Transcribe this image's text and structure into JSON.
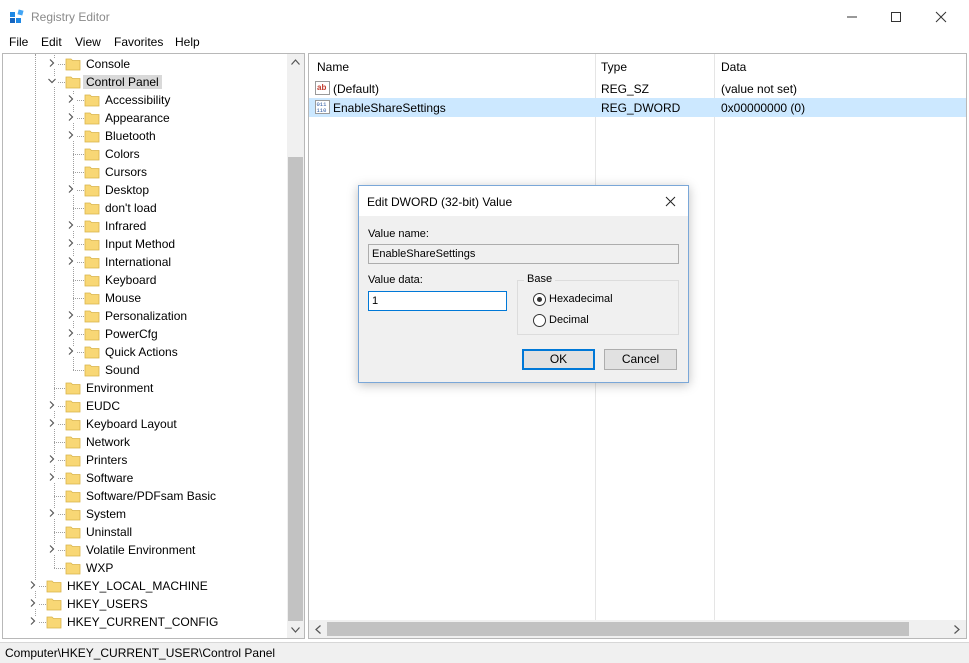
{
  "window": {
    "title": "Registry Editor"
  },
  "menu": [
    "File",
    "Edit",
    "View",
    "Favorites",
    "Help"
  ],
  "tree": {
    "items": [
      {
        "label": "Console",
        "level": 1,
        "expander": "collapsed"
      },
      {
        "label": "Control Panel",
        "level": 1,
        "expander": "expanded",
        "selected": true
      },
      {
        "label": "Accessibility",
        "level": 2,
        "expander": "collapsed"
      },
      {
        "label": "Appearance",
        "level": 2,
        "expander": "collapsed"
      },
      {
        "label": "Bluetooth",
        "level": 2,
        "expander": "collapsed"
      },
      {
        "label": "Colors",
        "level": 2,
        "expander": "none"
      },
      {
        "label": "Cursors",
        "level": 2,
        "expander": "none"
      },
      {
        "label": "Desktop",
        "level": 2,
        "expander": "collapsed"
      },
      {
        "label": "don't load",
        "level": 2,
        "expander": "none"
      },
      {
        "label": "Infrared",
        "level": 2,
        "expander": "collapsed"
      },
      {
        "label": "Input Method",
        "level": 2,
        "expander": "collapsed"
      },
      {
        "label": "International",
        "level": 2,
        "expander": "collapsed"
      },
      {
        "label": "Keyboard",
        "level": 2,
        "expander": "none"
      },
      {
        "label": "Mouse",
        "level": 2,
        "expander": "none"
      },
      {
        "label": "Personalization",
        "level": 2,
        "expander": "collapsed"
      },
      {
        "label": "PowerCfg",
        "level": 2,
        "expander": "collapsed"
      },
      {
        "label": "Quick Actions",
        "level": 2,
        "expander": "collapsed"
      },
      {
        "label": "Sound",
        "level": 2,
        "expander": "none"
      },
      {
        "label": "Environment",
        "level": 1,
        "expander": "none"
      },
      {
        "label": "EUDC",
        "level": 1,
        "expander": "collapsed"
      },
      {
        "label": "Keyboard Layout",
        "level": 1,
        "expander": "collapsed"
      },
      {
        "label": "Network",
        "level": 1,
        "expander": "none"
      },
      {
        "label": "Printers",
        "level": 1,
        "expander": "collapsed"
      },
      {
        "label": "Software",
        "level": 1,
        "expander": "collapsed"
      },
      {
        "label": "Software/PDFsam Basic",
        "level": 1,
        "expander": "none"
      },
      {
        "label": "System",
        "level": 1,
        "expander": "collapsed"
      },
      {
        "label": "Uninstall",
        "level": 1,
        "expander": "none"
      },
      {
        "label": "Volatile Environment",
        "level": 1,
        "expander": "collapsed"
      },
      {
        "label": "WXP",
        "level": 1,
        "expander": "none"
      },
      {
        "label": "HKEY_LOCAL_MACHINE",
        "level": 0,
        "expander": "collapsed"
      },
      {
        "label": "HKEY_USERS",
        "level": 0,
        "expander": "collapsed"
      },
      {
        "label": "HKEY_CURRENT_CONFIG",
        "level": 0,
        "expander": "collapsed"
      }
    ]
  },
  "values": {
    "columns": [
      "Name",
      "Type",
      "Data"
    ],
    "rows": [
      {
        "icon": "string-value-icon",
        "name": "(Default)",
        "type": "REG_SZ",
        "data": "(value not set)",
        "selected": false
      },
      {
        "icon": "dword-value-icon",
        "name": "EnableShareSettings",
        "type": "REG_DWORD",
        "data": "0x00000000 (0)",
        "selected": true
      }
    ]
  },
  "status": {
    "path": "Computer\\HKEY_CURRENT_USER\\Control Panel"
  },
  "dialog": {
    "title": "Edit DWORD (32-bit) Value",
    "value_name_label": "Value name:",
    "value_name": "EnableShareSettings",
    "value_data_label": "Value data:",
    "value_data": "1",
    "base_label": "Base",
    "hex_label": "Hexadecimal",
    "dec_label": "Decimal",
    "base_selected": "Hexadecimal",
    "ok_label": "OK",
    "cancel_label": "Cancel"
  },
  "colors": {
    "selection": "#cce8ff",
    "tree_selection": "#d9d9d9",
    "accent": "#0078d7",
    "folder": "#f8d775"
  }
}
